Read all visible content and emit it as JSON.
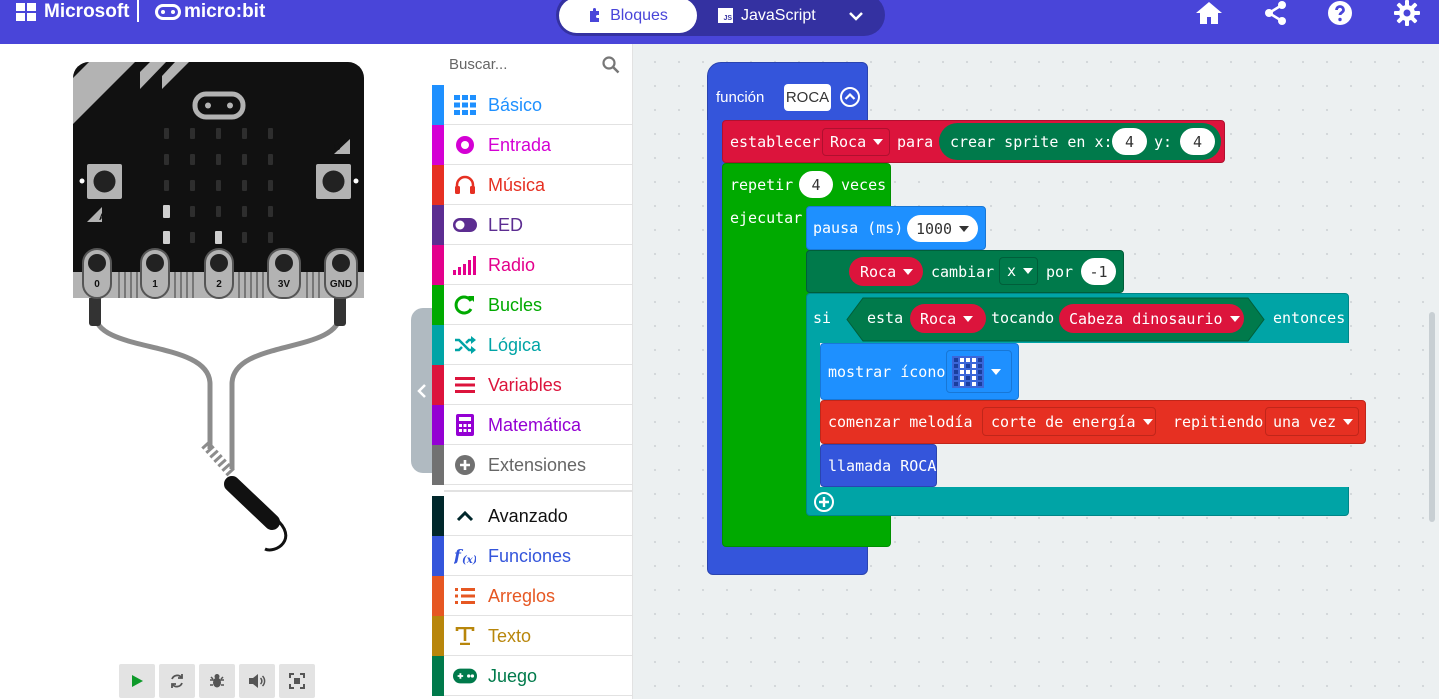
{
  "header": {
    "brand_microsoft": "Microsoft",
    "brand_microbit": "micro:bit",
    "tab_blocks": "Bloques",
    "tab_js": "JavaScript",
    "js_badge": "JS",
    "accent": "#4945d9"
  },
  "header_icons": [
    "home-icon",
    "share-icon",
    "help-icon",
    "settings-icon"
  ],
  "simulator": {
    "pins": [
      "0",
      "1",
      "2",
      "3V",
      "GND"
    ],
    "button_a": "A",
    "button_b": "B",
    "controls": [
      "play-icon",
      "restart-icon",
      "debug-icon",
      "mute-icon",
      "fullscreen-icon"
    ]
  },
  "toolbox": {
    "search_placeholder": "Buscar...",
    "categories": [
      {
        "label": "Básico",
        "color": "#1e90ff",
        "icon": "grid-icon"
      },
      {
        "label": "Entrada",
        "color": "#d400d4",
        "icon": "input-icon"
      },
      {
        "label": "Música",
        "color": "#e63022",
        "icon": "headphones-icon"
      },
      {
        "label": "LED",
        "color": "#5c2d91",
        "icon": "toggle-icon"
      },
      {
        "label": "Radio",
        "color": "#e3008c",
        "icon": "signal-icon"
      },
      {
        "label": "Bucles",
        "color": "#00aa00",
        "icon": "loop-icon"
      },
      {
        "label": "Lógica",
        "color": "#00a4a6",
        "icon": "shuffle-icon"
      },
      {
        "label": "Variables",
        "color": "#dc143c",
        "icon": "list-icon"
      },
      {
        "label": "Matemática",
        "color": "#9400d3",
        "icon": "calculator-icon"
      },
      {
        "label": "Extensiones",
        "color": "#717171",
        "icon": "plus-circle-icon"
      },
      {
        "label": "Avanzado",
        "color": "#00272b",
        "icon": "chevron-up-icon"
      },
      {
        "label": "Funciones",
        "color": "#3455db",
        "icon": "function-icon"
      },
      {
        "label": "Arreglos",
        "color": "#e65722",
        "icon": "array-icon"
      },
      {
        "label": "Texto",
        "color": "#b8860b",
        "icon": "text-icon"
      },
      {
        "label": "Juego",
        "color": "#007a4b",
        "icon": "gamepad-icon"
      }
    ]
  },
  "blocks": {
    "function_kw": "función",
    "function_name": "ROCA",
    "set_kw": "establecer",
    "set_var": "Roca",
    "set_to": "para",
    "create_sprite": "crear sprite en x:",
    "x_val": "4",
    "y_kw": "y:",
    "y_val": "4",
    "repeat_kw": "repetir",
    "repeat_count": "4",
    "repeat_times": "veces",
    "do_kw": "ejecutar",
    "pause_kw": "pausa (ms)",
    "pause_val": "1000",
    "change_var": "Roca",
    "change_kw": "cambiar",
    "change_axis": "x",
    "change_by": "por",
    "change_val": "-1",
    "if_kw": "si",
    "is_kw": "esta",
    "touch_var": "Roca",
    "touching_kw": "tocando",
    "touch_target": "Cabeza dinosaurio",
    "then_kw": "entonces",
    "show_icon_kw": "mostrar ícono",
    "melody_kw": "comenzar melodía",
    "melody_name": "corte de energía",
    "repeat_mode_kw": "repitiendo",
    "repeat_mode": "una vez",
    "call_kw": "llamada ROCA"
  },
  "colors": {
    "function": "#3455db",
    "variables": "#dc143c",
    "game": "#007a4b",
    "loops": "#00aa00",
    "basic": "#1e90ff",
    "logic": "#00a4a6",
    "music": "#e63022"
  }
}
